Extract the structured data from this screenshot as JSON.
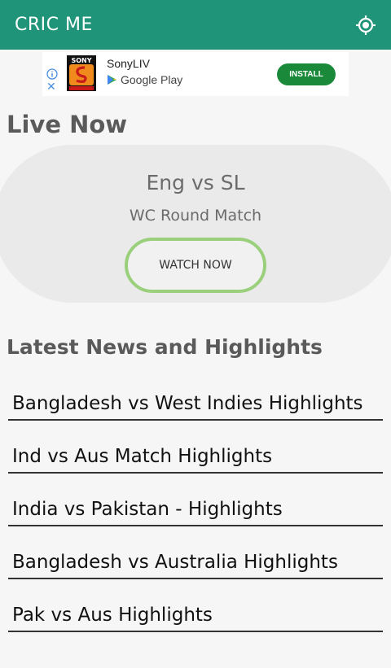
{
  "appbar": {
    "title": "CRIC ME",
    "action_icon": "gps-locate-icon"
  },
  "ad": {
    "logo_text": "SONY",
    "app_name": "SonyLIV",
    "store_name": "Google Play",
    "install_label": "INSTALL"
  },
  "live": {
    "heading": "Live Now",
    "match_title": "Eng vs SL",
    "match_subtitle": "WC Round Match",
    "watch_label": "WATCH NOW"
  },
  "news": {
    "heading": "Latest News and Highlights",
    "items": [
      "Bangladesh vs West Indies Highlights",
      "Ind vs Aus Match Highlights",
      "India vs Pakistan - Highlights",
      "Bangladesh vs Australia Highlights",
      "Pak vs Aus Highlights"
    ]
  },
  "colors": {
    "appbar": "#1f9479",
    "watch_border": "#9ad07b",
    "install_button": "#1a8a3a"
  }
}
